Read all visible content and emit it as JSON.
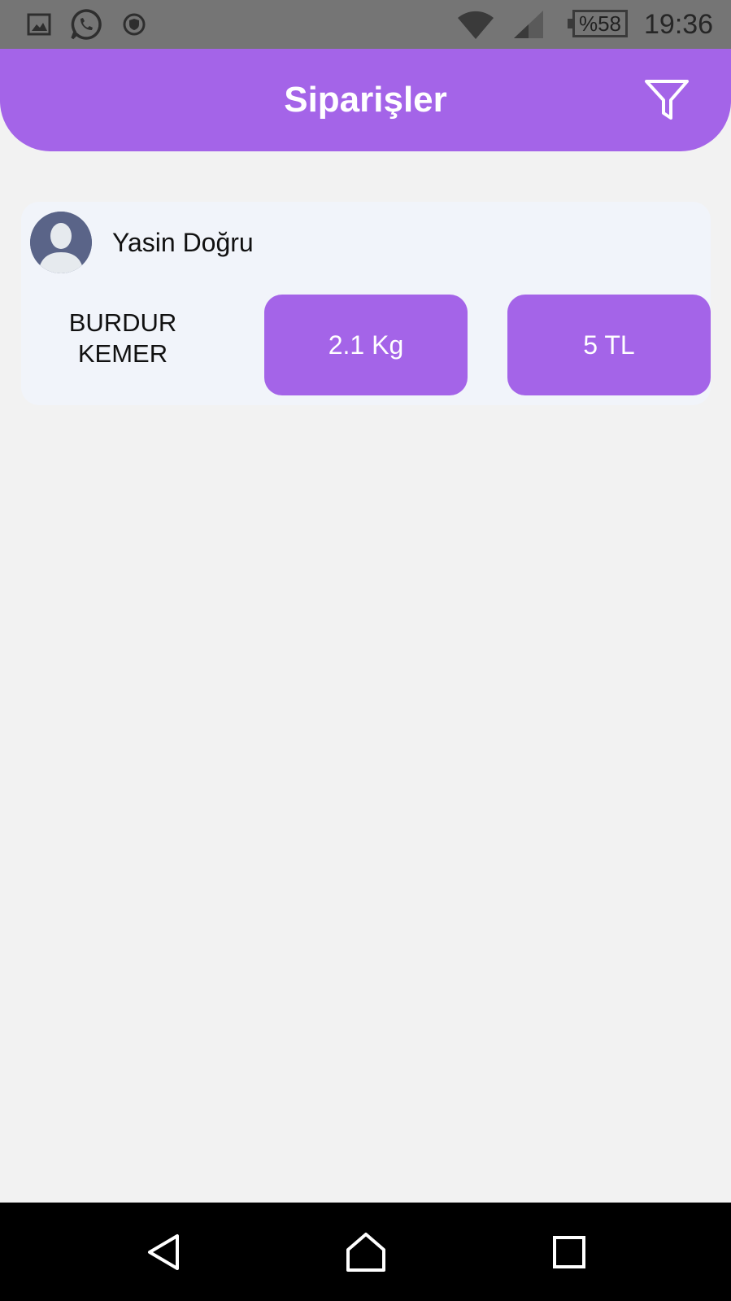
{
  "status_bar": {
    "battery": "%58",
    "time": "19:36",
    "icons": [
      "gallery-icon",
      "whatsapp-icon",
      "vpn-shield-icon",
      "wifi-icon",
      "signal-icon",
      "battery-icon"
    ]
  },
  "header": {
    "title": "Siparişler",
    "filter_icon": "filter-icon",
    "color": "#a464e8"
  },
  "orders": [
    {
      "customer_name": "Yasin Doğru",
      "location_line1": "BURDUR",
      "location_line2": "KEMER",
      "weight": "2.1 Kg",
      "price": "5 TL"
    }
  ],
  "nav_bar": {
    "icons": [
      "back-icon",
      "home-icon",
      "recents-icon"
    ]
  }
}
